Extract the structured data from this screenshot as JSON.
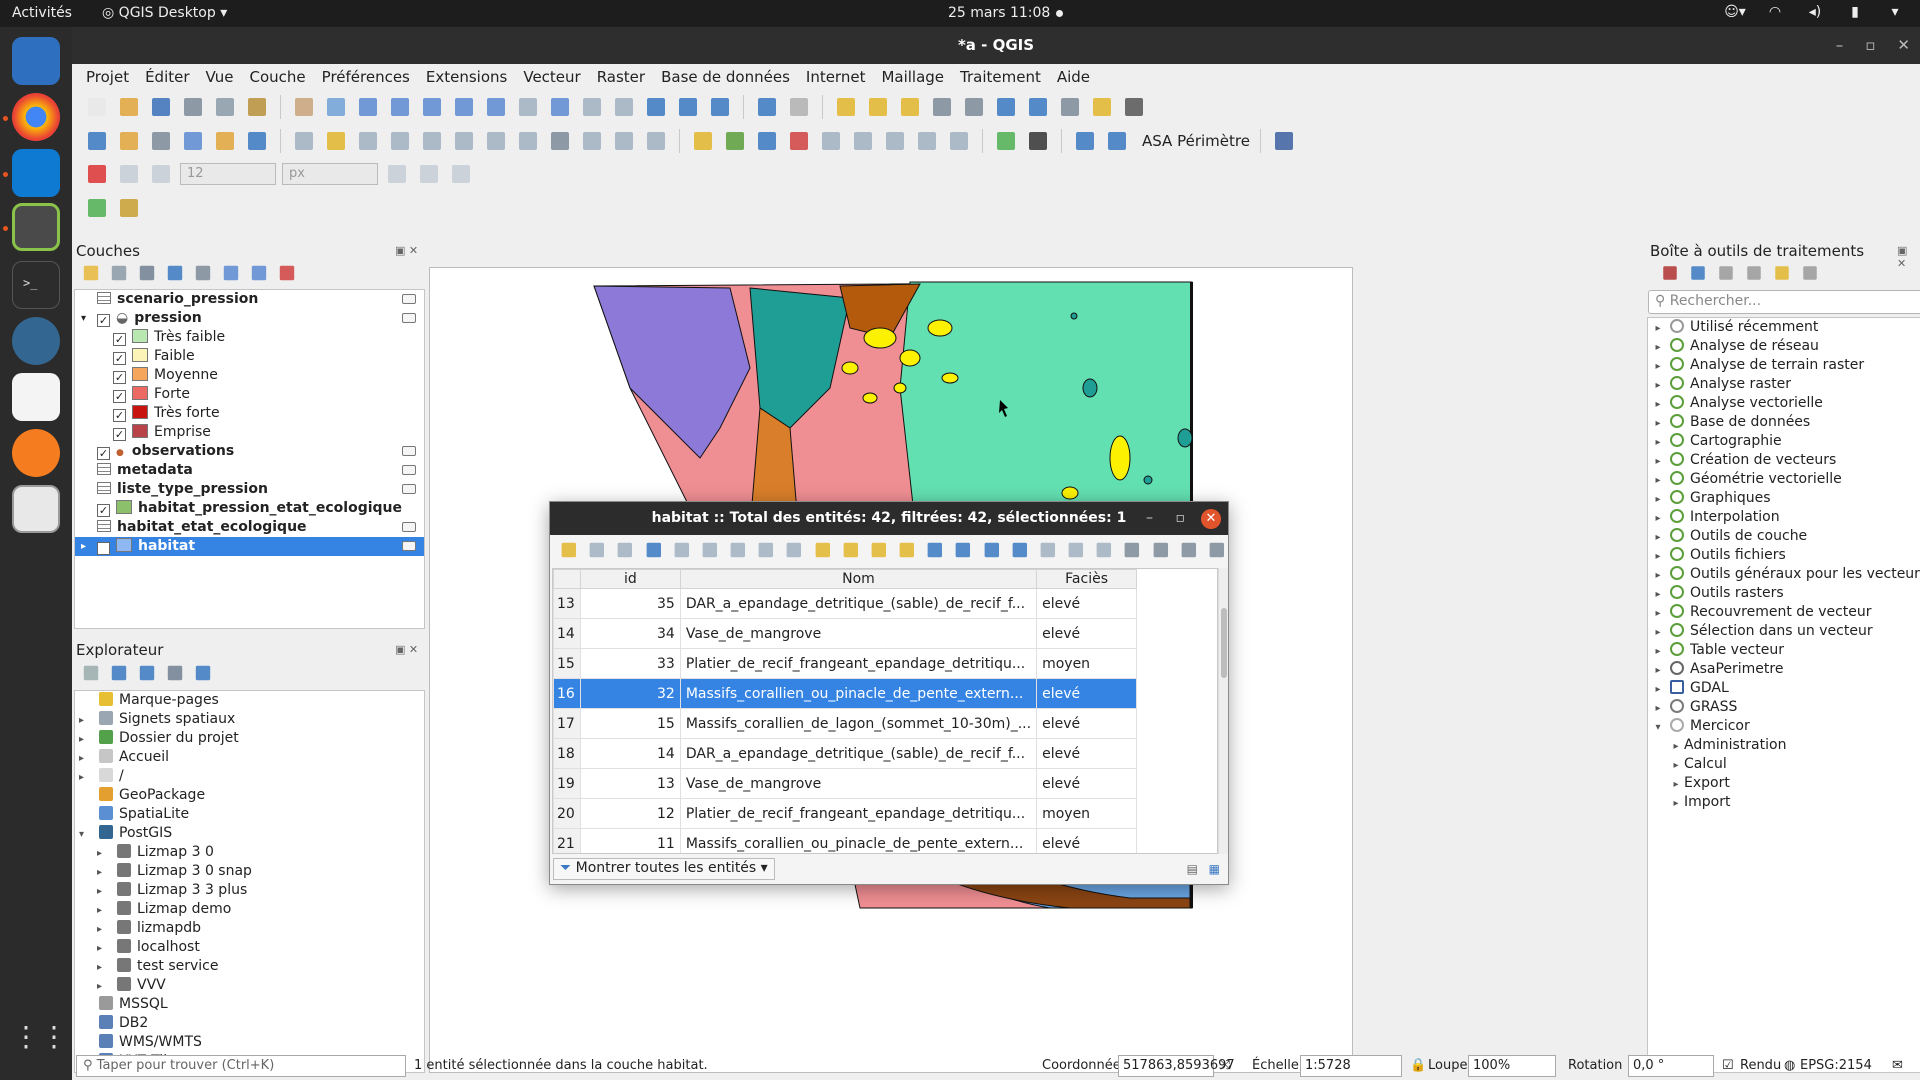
{
  "topbar": {
    "activities": "Activités",
    "app_menu": "QGIS Desktop",
    "clock": "25 mars  11:08"
  },
  "window": {
    "title": "*a - QGIS",
    "menu": [
      "Projet",
      "Éditer",
      "Vue",
      "Couche",
      "Préférences",
      "Extensions",
      "Vecteur",
      "Raster",
      "Base de données",
      "Internet",
      "Maillage",
      "Traitement",
      "Aide"
    ]
  },
  "toolbar": {
    "snap_tolerance": "12",
    "snap_units": "px",
    "plugin_label": "ASA Périmètre"
  },
  "layers_panel": {
    "title": "Couches",
    "items": [
      {
        "label": "scenario_pression",
        "kind": "table",
        "bold": true
      },
      {
        "label": "pression",
        "kind": "group",
        "bold": true,
        "checked": true
      },
      {
        "label": "Très faible",
        "kind": "class",
        "color": "#b9e7b0",
        "checked": true
      },
      {
        "label": "Faible",
        "kind": "class",
        "color": "#fbf3b8",
        "checked": true
      },
      {
        "label": "Moyenne",
        "kind": "class",
        "color": "#f6a55c",
        "checked": true
      },
      {
        "label": "Forte",
        "kind": "class",
        "color": "#ec6a63",
        "checked": true
      },
      {
        "label": "Très forte",
        "kind": "class",
        "color": "#c8140f",
        "checked": true
      },
      {
        "label": "Emprise",
        "kind": "class",
        "color": "#b8444a",
        "checked": true
      },
      {
        "label": "observations",
        "kind": "point",
        "bold": true,
        "checked": true
      },
      {
        "label": "metadata",
        "kind": "table",
        "bold": true
      },
      {
        "label": "liste_type_pression",
        "kind": "table",
        "bold": true
      },
      {
        "label": "habitat_pression_etat_ecologique",
        "kind": "poly",
        "bold": true,
        "checked": true,
        "color": "#8dc06a"
      },
      {
        "label": "habitat_etat_ecologique",
        "kind": "table",
        "bold": true
      },
      {
        "label": "habitat",
        "kind": "poly",
        "bold": true,
        "checked": true,
        "selected": true,
        "color": "#8fb7f1"
      }
    ]
  },
  "explorer_panel": {
    "title": "Explorateur",
    "items": [
      {
        "label": "Marque-pages",
        "icon_color": "#e6c032",
        "arrow": ""
      },
      {
        "label": "Signets spatiaux",
        "icon_color": "#9aa6b2",
        "arrow": "▸"
      },
      {
        "label": "Dossier du projet",
        "icon_color": "#53a14b",
        "arrow": "▸"
      },
      {
        "label": "Accueil",
        "icon_color": "#c6c6c6",
        "arrow": "▸"
      },
      {
        "label": "/",
        "icon_color": "#d8d8d8",
        "arrow": "▸"
      },
      {
        "label": "GeoPackage",
        "icon_color": "#e3a030",
        "arrow": ""
      },
      {
        "label": "SpatiaLite",
        "icon_color": "#5a8fd3",
        "arrow": ""
      },
      {
        "label": "PostGIS",
        "icon_color": "#336791",
        "arrow": "▾"
      },
      {
        "label": "Lizmap 3 0",
        "icon_color": "#777777",
        "arrow": "▸",
        "indent": true
      },
      {
        "label": "Lizmap 3 0 snap",
        "icon_color": "#777777",
        "arrow": "▸",
        "indent": true
      },
      {
        "label": "Lizmap 3 3 plus",
        "icon_color": "#777777",
        "arrow": "▸",
        "indent": true
      },
      {
        "label": "Lizmap demo",
        "icon_color": "#777777",
        "arrow": "▸",
        "indent": true
      },
      {
        "label": "lizmapdb",
        "icon_color": "#777777",
        "arrow": "▸",
        "indent": true
      },
      {
        "label": "localhost",
        "icon_color": "#777777",
        "arrow": "▸",
        "indent": true
      },
      {
        "label": "test service",
        "icon_color": "#777777",
        "arrow": "▸",
        "indent": true
      },
      {
        "label": "VVV",
        "icon_color": "#777777",
        "arrow": "▸",
        "indent": true
      },
      {
        "label": "MSSQL",
        "icon_color": "#9a9a9a",
        "arrow": ""
      },
      {
        "label": "DB2",
        "icon_color": "#5b80b8",
        "arrow": ""
      },
      {
        "label": "WMS/WMTS",
        "icon_color": "#5b80b8",
        "arrow": ""
      },
      {
        "label": "XYZ Tiles",
        "icon_color": "#5b80b8",
        "arrow": "▸"
      }
    ]
  },
  "processing_panel": {
    "title": "Boîte à outils de traitements",
    "search_placeholder": "Rechercher...",
    "items": [
      {
        "label": "Utilisé récemment",
        "arrow": "▸",
        "icon": "clock"
      },
      {
        "label": "Analyse de réseau",
        "arrow": "▸",
        "icon": "q"
      },
      {
        "label": "Analyse de terrain raster",
        "arrow": "▸",
        "icon": "q"
      },
      {
        "label": "Analyse raster",
        "arrow": "▸",
        "icon": "q"
      },
      {
        "label": "Analyse vectorielle",
        "arrow": "▸",
        "icon": "q"
      },
      {
        "label": "Base de données",
        "arrow": "▸",
        "icon": "q"
      },
      {
        "label": "Cartographie",
        "arrow": "▸",
        "icon": "q"
      },
      {
        "label": "Création de vecteurs",
        "arrow": "▸",
        "icon": "q"
      },
      {
        "label": "Géométrie vectorielle",
        "arrow": "▸",
        "icon": "q"
      },
      {
        "label": "Graphiques",
        "arrow": "▸",
        "icon": "q"
      },
      {
        "label": "Interpolation",
        "arrow": "▸",
        "icon": "q"
      },
      {
        "label": "Outils de couche",
        "arrow": "▸",
        "icon": "q"
      },
      {
        "label": "Outils fichiers",
        "arrow": "▸",
        "icon": "q"
      },
      {
        "label": "Outils généraux pour les vecteurs",
        "arrow": "▸",
        "icon": "q"
      },
      {
        "label": "Outils rasters",
        "arrow": "▸",
        "icon": "q"
      },
      {
        "label": "Recouvrement de vecteur",
        "arrow": "▸",
        "icon": "q"
      },
      {
        "label": "Sélection dans un vecteur",
        "arrow": "▸",
        "icon": "q"
      },
      {
        "label": "Table vecteur",
        "arrow": "▸",
        "icon": "q"
      },
      {
        "label": "AsaPerimetre",
        "arrow": "▸",
        "icon": "gear"
      },
      {
        "label": "GDAL",
        "arrow": "▸",
        "icon": "gdal"
      },
      {
        "label": "GRASS",
        "arrow": "▸",
        "icon": "grass"
      },
      {
        "label": "Mercicor",
        "arrow": "▾",
        "icon": "merc"
      },
      {
        "label": "Administration",
        "arrow": "▸",
        "icon": "",
        "indent": true
      },
      {
        "label": "Calcul",
        "arrow": "▸",
        "icon": "",
        "indent": true
      },
      {
        "label": "Export",
        "arrow": "▸",
        "icon": "",
        "indent": true
      },
      {
        "label": "Import",
        "arrow": "▸",
        "icon": "",
        "indent": true
      }
    ]
  },
  "attribute_table": {
    "title": "habitat :: Total des entités: 42, filtrées: 42, sélectionnées: 1",
    "columns": [
      "id",
      "Nom",
      "Faciès"
    ],
    "rows": [
      {
        "n": "13",
        "id": "35",
        "nom": "DAR_a_epandage_detritique_(sable)_de_recif_f...",
        "facies": "elevé"
      },
      {
        "n": "14",
        "id": "34",
        "nom": "Vase_de_mangrove",
        "facies": "elevé"
      },
      {
        "n": "15",
        "id": "33",
        "nom": "Platier_de_recif_frangeant_epandage_detritiqu...",
        "facies": "moyen"
      },
      {
        "n": "16",
        "id": "32",
        "nom": "Massifs_corallien_ou_pinacle_de_pente_extern...",
        "facies": "elevé",
        "selected": true
      },
      {
        "n": "17",
        "id": "15",
        "nom": "Massifs_corallien_de_lagon_(sommet_10-30m)_...",
        "facies": "elevé"
      },
      {
        "n": "18",
        "id": "14",
        "nom": "DAR_a_epandage_detritique_(sable)_de_recif_f...",
        "facies": "elevé"
      },
      {
        "n": "19",
        "id": "13",
        "nom": "Vase_de_mangrove",
        "facies": "elevé"
      },
      {
        "n": "20",
        "id": "12",
        "nom": "Platier_de_recif_frangeant_epandage_detritiqu...",
        "facies": "moyen"
      },
      {
        "n": "21",
        "id": "11",
        "nom": "Massifs_corallien_ou_pinacle_de_pente_extern...",
        "facies": "elevé"
      }
    ],
    "filter_button": "Montrer toutes les entités"
  },
  "statusbar": {
    "search_placeholder": "Taper pour trouver (Ctrl+K)",
    "message": "1 entité sélectionnée dans la couche habitat.",
    "coord_label": "Coordonnée",
    "coord_value": "517863,8593697",
    "scale_label": "Échelle",
    "scale_value": "1:5728",
    "magnifier_label": "Loupe",
    "magnifier_value": "100%",
    "rotation_label": "Rotation",
    "rotation_value": "0,0 °",
    "render_label": "Rendu",
    "crs": "EPSG:2154"
  },
  "colors": {
    "selection": "#3584e4",
    "map_purple": "#8c79d8",
    "map_pink": "#f08f93",
    "map_teal": "#1f9e96",
    "map_mint": "#63e0b2",
    "map_brown": "#b35a0c",
    "map_yellow": "#fbf100"
  }
}
